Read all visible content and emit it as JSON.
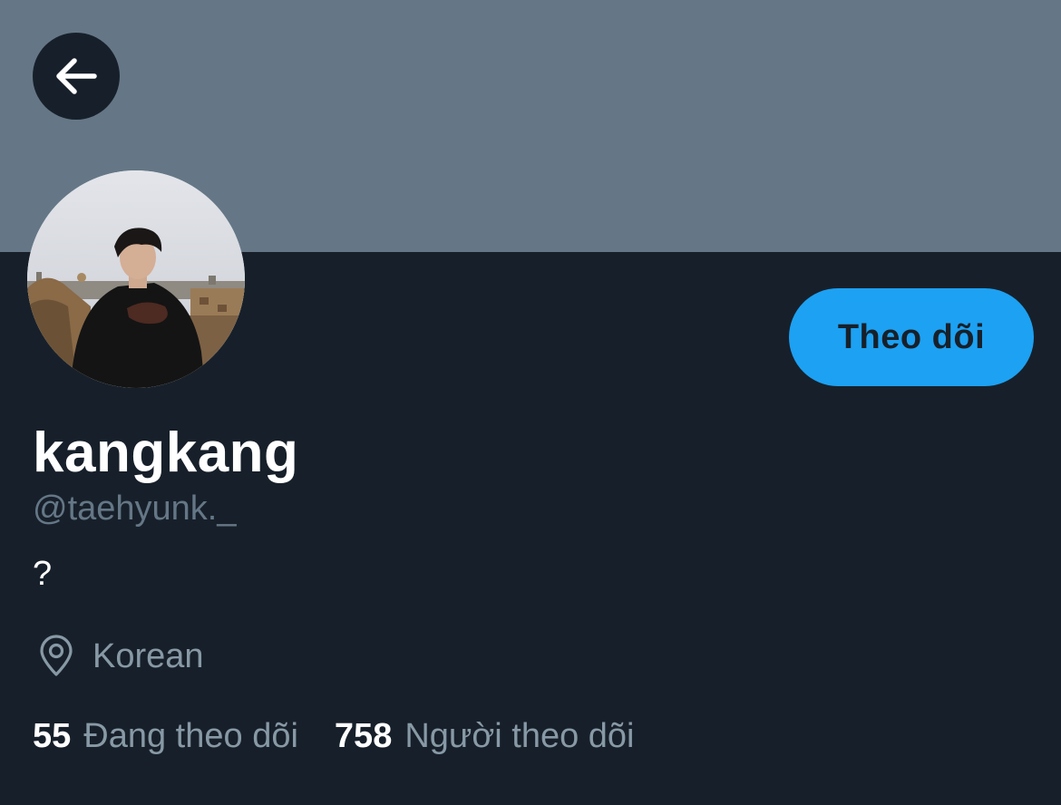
{
  "header": {
    "back_icon": "arrow-left-icon",
    "banner_color": "#657786"
  },
  "profile": {
    "display_name": "kangkang",
    "handle": "@taehyunk._",
    "bio": "?",
    "location_icon": "map-pin-icon",
    "location": "Korean",
    "avatar_alt": "profile photo"
  },
  "actions": {
    "follow_label": "Theo dõi",
    "accent_color": "#1da1f2"
  },
  "stats": {
    "following_count": "55",
    "following_label": "Đang theo dõi",
    "followers_count": "758",
    "followers_label": "Người theo dõi"
  }
}
